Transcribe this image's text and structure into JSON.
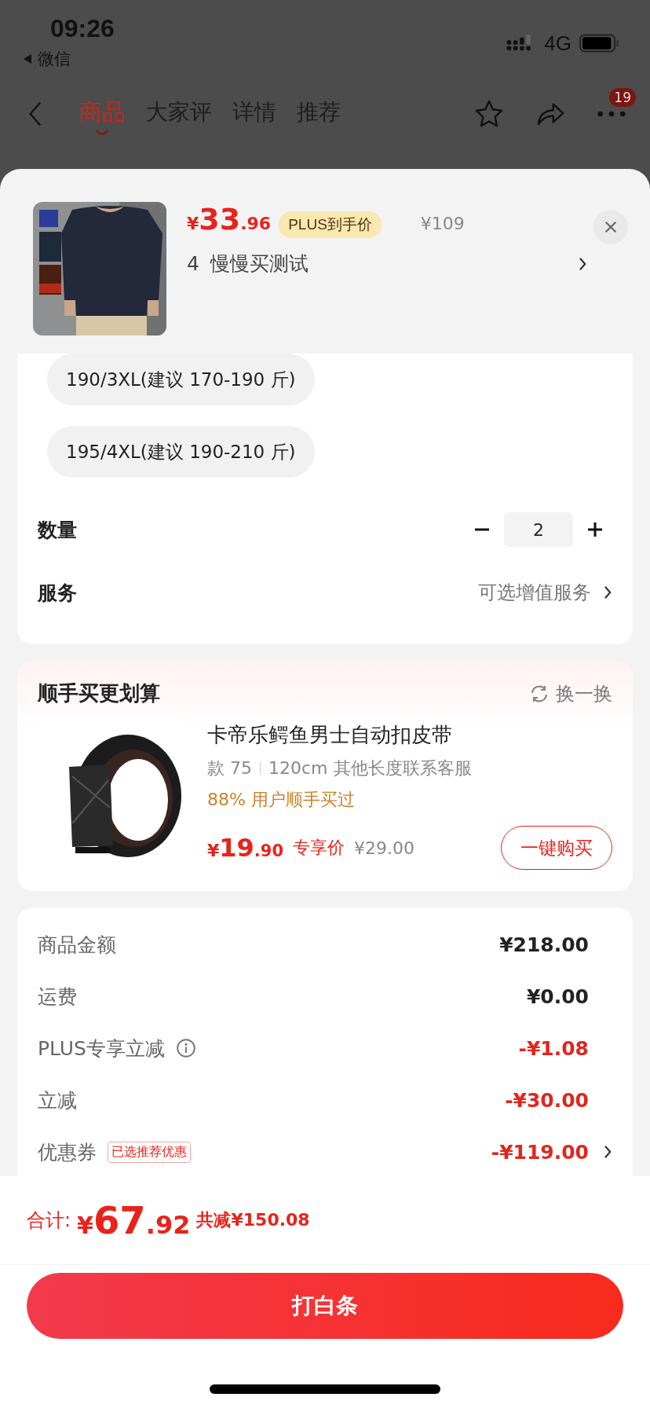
{
  "status_bar": {
    "time": "09:26",
    "back_app": "微信",
    "network": "4G"
  },
  "nav": {
    "tabs": [
      {
        "label": "商品",
        "selected": true
      },
      {
        "label": "大家评",
        "selected": false
      },
      {
        "label": "详情",
        "selected": false
      },
      {
        "label": "推荐",
        "selected": false
      }
    ],
    "badge": "19"
  },
  "sku": {
    "currency": "¥",
    "price_integer": "33",
    "price_decimal": ".96",
    "price_tag": "PLUS到手价",
    "original_price": "¥109",
    "count": "4",
    "selection": "慢慢买测试"
  },
  "size_options": [
    {
      "label": "190/3XL(建议 170-190 斤)",
      "selected": false
    },
    {
      "label": "195/4XL(建议 190-210 斤)",
      "selected": false
    }
  ],
  "quantity": {
    "label": "数量",
    "value": "2"
  },
  "service": {
    "label": "服务",
    "value": "可选增值服务"
  },
  "addon": {
    "title": "顺手买更划算",
    "refresh": "换一换",
    "name": "卡帝乐鳄鱼男士自动扣皮带",
    "spec_1": "款 75",
    "spec_2": "120cm 其他长度联系客服",
    "social_proof": "88% 用户顺手买过",
    "currency": "¥",
    "price_integer": "19",
    "price_decimal": ".90",
    "price_tag": "专享价",
    "original_price": "¥29.00",
    "buy_button": "一键购买"
  },
  "summary": [
    {
      "label": "商品金额",
      "amount": "¥218.00",
      "kind": "plain",
      "info": false,
      "arrow": false
    },
    {
      "label": "运费",
      "amount": "¥0.00",
      "kind": "plain",
      "info": false,
      "arrow": false
    },
    {
      "label": "PLUS专享立减",
      "amount": "-¥1.08",
      "kind": "discount",
      "info": true,
      "arrow": false
    },
    {
      "label": "立减",
      "amount": "-¥30.00",
      "kind": "discount",
      "info": false,
      "arrow": false
    },
    {
      "label": "优惠券",
      "tag": "已选推荐优惠",
      "amount": "-¥119.00",
      "kind": "discount",
      "info": false,
      "arrow": true
    }
  ],
  "footer": {
    "total_label": "合计:",
    "currency": "¥",
    "integer": "67",
    "decimal": ".92",
    "saved": "共减¥150.08",
    "pay_button": "打白条"
  }
}
